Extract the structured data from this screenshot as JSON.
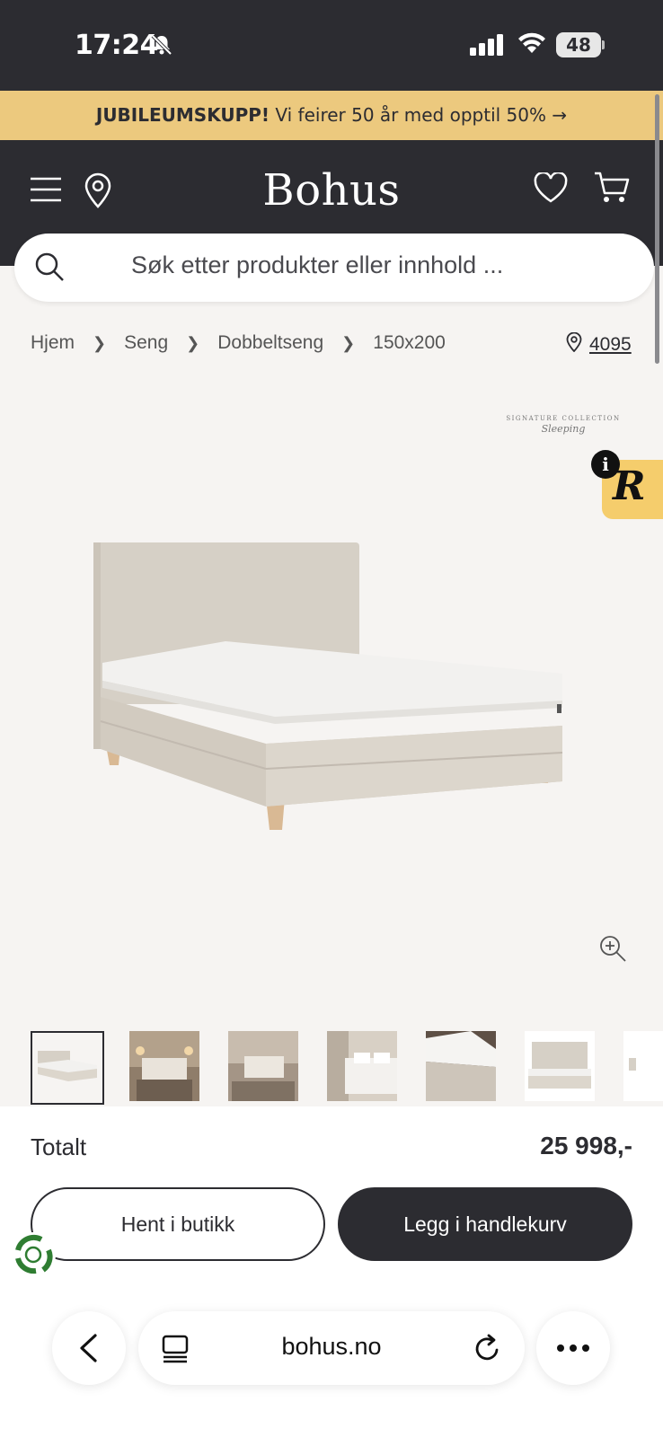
{
  "status_bar": {
    "time": "17:24",
    "battery": "48"
  },
  "promo": {
    "bold": "JUBILEUMSKUPP!",
    "text": " Vi feirer 50 år med opptil 50% →"
  },
  "header": {
    "logo": "Bohus"
  },
  "search": {
    "placeholder": "Søk etter produkter eller innhold ..."
  },
  "breadcrumb": {
    "items": [
      "Hjem",
      "Seng",
      "Dobbeltseng",
      "150x200"
    ],
    "store_number": "4095"
  },
  "badge": {
    "line1": "SIGNATURE COLLECTION",
    "line2": "Sleeping"
  },
  "r_widget": {
    "info": "i",
    "letter": "R"
  },
  "gallery": {
    "thumbnail_count": 7,
    "selected_index": 0
  },
  "purchase": {
    "total_label": "Totalt",
    "total_price": "25 998,-",
    "pickup_button": "Hent i butikk",
    "cart_button": "Legg i handlekurv"
  },
  "browser": {
    "domain": "bohus.no"
  },
  "colors": {
    "dark": "#2c2c31",
    "promo": "#ecc97e",
    "background": "#f6f4f2",
    "bed_fabric": "#d8d2c8"
  }
}
